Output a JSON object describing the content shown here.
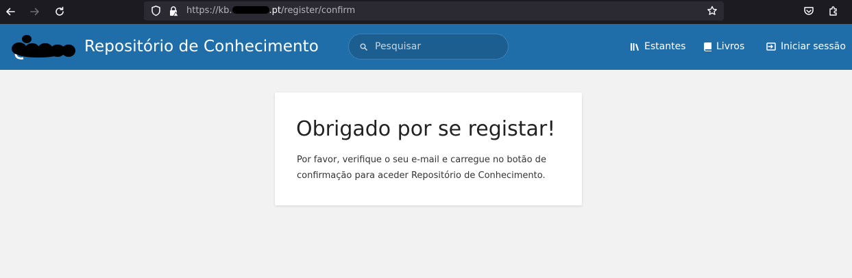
{
  "browser": {
    "url_prefix": "https://kb.",
    "url_domain_tail": ".pt",
    "url_path": "/register/confirm"
  },
  "header": {
    "title": "Repositório de Conhecimento",
    "search": {
      "placeholder": "Pesquisar"
    },
    "nav": [
      {
        "label": "Estantes",
        "icon": "bookshelf-icon"
      },
      {
        "label": "Livros",
        "icon": "book-icon"
      },
      {
        "label": "Iniciar sessão",
        "icon": "login-icon"
      }
    ]
  },
  "card": {
    "title": "Obrigado por se registar!",
    "line1": "Por favor, verifique o seu e-mail e carregue no botão de",
    "line2": "confirmação para aceder Repositório de Conhecimento."
  },
  "colors": {
    "header_bg": "#1f6ea9",
    "page_bg": "#f2f2f2",
    "browser_bg": "#1c1b22"
  }
}
